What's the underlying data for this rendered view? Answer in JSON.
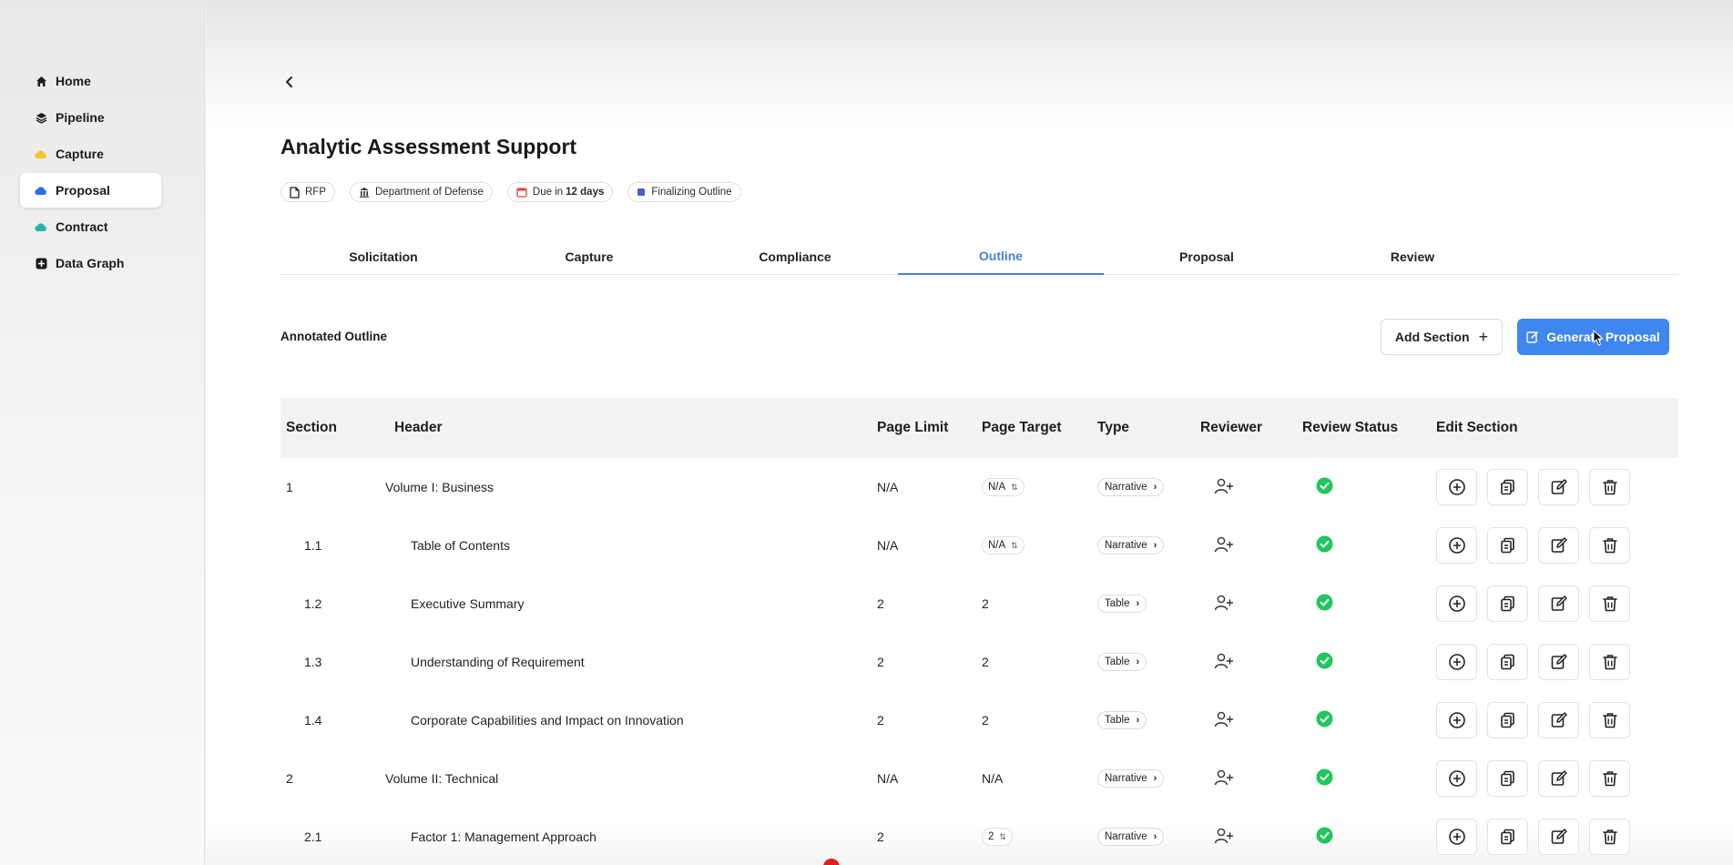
{
  "sidebar": {
    "items": [
      {
        "label": "Home",
        "icon": "home-icon"
      },
      {
        "label": "Pipeline",
        "icon": "layers-icon"
      },
      {
        "label": "Capture",
        "icon": "cloud-icon"
      },
      {
        "label": "Proposal",
        "icon": "cloud-icon",
        "active": true
      },
      {
        "label": "Contract",
        "icon": "cloud-icon"
      },
      {
        "label": "Data Graph",
        "icon": "graph-icon"
      }
    ]
  },
  "page": {
    "title": "Analytic Assessment Support",
    "chips": {
      "rfp": "RFP",
      "agency": "Department of Defense",
      "due_prefix": "Due in",
      "due_value": "12 days",
      "status": "Finalizing Outline"
    }
  },
  "tabs": [
    "Solicitation",
    "Capture",
    "Compliance",
    "Outline",
    "Proposal",
    "Review"
  ],
  "active_tab": "Outline",
  "outline": {
    "label": "Annotated Outline",
    "add_button": "Add Section",
    "add_button_icon": "+",
    "generate_button": "Generate Proposal"
  },
  "table": {
    "columns": [
      "Section",
      "Header",
      "Page Limit",
      "Page Target",
      "Type",
      "Reviewer",
      "Review Status",
      "Edit Section"
    ],
    "rows": [
      {
        "section": "1",
        "header": "Volume I: Business",
        "page_limit": "N/A",
        "page_target": "N/A",
        "target_stepper": true,
        "type": "Narrative",
        "level": 0
      },
      {
        "section": "1.1",
        "header": "Table of Contents",
        "page_limit": "N/A",
        "page_target": "N/A",
        "target_stepper": true,
        "type": "Narrative",
        "level": 1
      },
      {
        "section": "1.2",
        "header": "Executive Summary",
        "page_limit": "2",
        "page_target": "2",
        "target_stepper": false,
        "type": "Table",
        "level": 1
      },
      {
        "section": "1.3",
        "header": "Understanding of Requirement",
        "page_limit": "2",
        "page_target": "2",
        "target_stepper": false,
        "type": "Table",
        "level": 1
      },
      {
        "section": "1.4",
        "header": "Corporate Capabilities and Impact on Innovation",
        "page_limit": "2",
        "page_target": "2",
        "target_stepper": false,
        "type": "Table",
        "level": 1
      },
      {
        "section": "2",
        "header": "Volume II: Technical",
        "page_limit": "N/A",
        "page_target": "N/A",
        "target_stepper": false,
        "type": "Narrative",
        "level": 0
      },
      {
        "section": "2.1",
        "header": "Factor 1: Management Approach",
        "page_limit": "2",
        "page_target": "2",
        "target_stepper": true,
        "type": "Narrative",
        "level": 1
      }
    ]
  },
  "colors": {
    "accent": "#4a7fd6",
    "primary_button": "#3f86ee",
    "status_green": "#22c55e",
    "calendar_red": "#e0483e",
    "status_square": "#4660c9"
  }
}
